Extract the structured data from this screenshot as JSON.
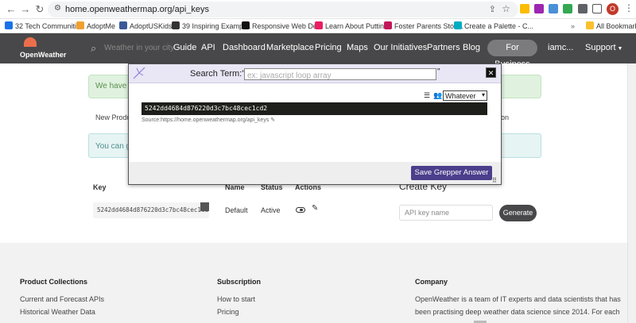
{
  "browser": {
    "url": "home.openweathermap.org/api_keys",
    "bookmarks": [
      {
        "label": "32 Tech Communiti...",
        "color": "#1a73e8"
      },
      {
        "label": "AdoptMe",
        "color": "#f0a030"
      },
      {
        "label": "AdoptUSKids",
        "color": "#3b5998"
      },
      {
        "label": "39 Inspiring Exampl...",
        "color": "#333333"
      },
      {
        "label": "Responsive Web De...",
        "color": "#111111"
      },
      {
        "label": "Learn About Puttin...",
        "color": "#e91e63"
      },
      {
        "label": "Foster Parents Stoc...",
        "color": "#c2185b"
      },
      {
        "label": "Create a Palette - C...",
        "color": "#00acc1"
      }
    ],
    "all_bookmarks": "All Bookmarks",
    "profile_initial": "O"
  },
  "header": {
    "logo": "OpenWeather",
    "search_placeholder": "Weather in your city",
    "nav": [
      "Guide",
      "API",
      "Dashboard",
      "Marketplace",
      "Pricing",
      "Maps",
      "Our Initiatives",
      "Partners",
      "Blog"
    ],
    "business": "For Business",
    "user": "iamc...",
    "support": "Support"
  },
  "page": {
    "alert_green": "We have se",
    "tab_first": "New Produ",
    "tab_tail": "ion",
    "alert_blue": "You can ge",
    "table_headers": {
      "key": "Key",
      "name": "Name",
      "status": "Status",
      "actions": "Actions"
    },
    "row": {
      "key": "5242dd4684d876220d3c7bc48cec1cd",
      "name": "Default",
      "status": "Active"
    },
    "create_key_title": "Create Key",
    "api_key_placeholder": "API key name",
    "generate": "Generate"
  },
  "grepper": {
    "label": "Search Term:\"",
    "placeholder": "ex: javascript loop array",
    "quote_end": "\"",
    "filter": "Whatever",
    "code": "5242dd4684d876220d3c7bc48cec1cd2",
    "source": "Source:https://home.openweathermap.org/api_keys",
    "save": "Save Grepper Answer"
  },
  "footer": {
    "product_title": "Product Collections",
    "product_links": [
      "Current and Forecast APIs",
      "Historical Weather Data"
    ],
    "subscription_title": "Subscription",
    "subscription_links": [
      "How to start",
      "Pricing"
    ],
    "company_title": "Company",
    "company_lines": [
      "OpenWeather is a team of IT experts and data scientists that has",
      "been practising deep weather data science since 2014. For each"
    ]
  },
  "colors": {
    "header_bg": "#48484a",
    "brand_orange": "#eb6e4b",
    "grepper_button": "#4b3f8c"
  }
}
